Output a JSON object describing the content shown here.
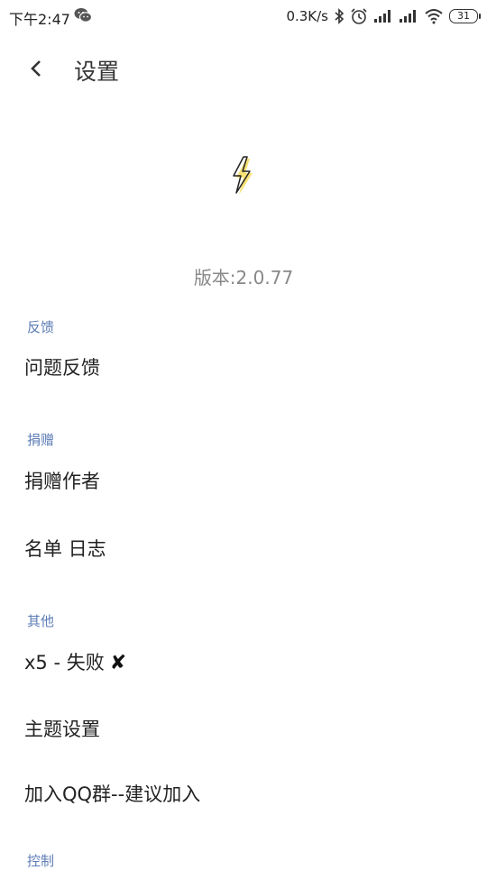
{
  "status_bar": {
    "time": "下午2:47",
    "net_speed": "0.3K/s",
    "battery": "31",
    "icons": [
      "wechat-icon",
      "bluetooth-icon",
      "alarm-icon",
      "signal-icon",
      "signal-icon",
      "wifi-icon",
      "battery-icon"
    ]
  },
  "app_bar": {
    "title": "设置",
    "back_icon": "chevron-left-icon"
  },
  "logo": {
    "icon": "lightning-bolt-icon",
    "accent_color": "#f5d63d"
  },
  "version": "版本:2.0.77",
  "sections": [
    {
      "header": "反馈",
      "items": [
        "问题反馈"
      ]
    },
    {
      "header": "捐赠",
      "items": [
        "捐赠作者",
        "名单 日志"
      ]
    },
    {
      "header": "其他",
      "items": [
        "x5 - 失败",
        "主题设置",
        "加入QQ群--建议加入"
      ]
    },
    {
      "header": "控制",
      "items": []
    }
  ],
  "x5_status_mark": "✘",
  "colors": {
    "section_header": "#5c7cb5",
    "version_text": "#888888"
  }
}
